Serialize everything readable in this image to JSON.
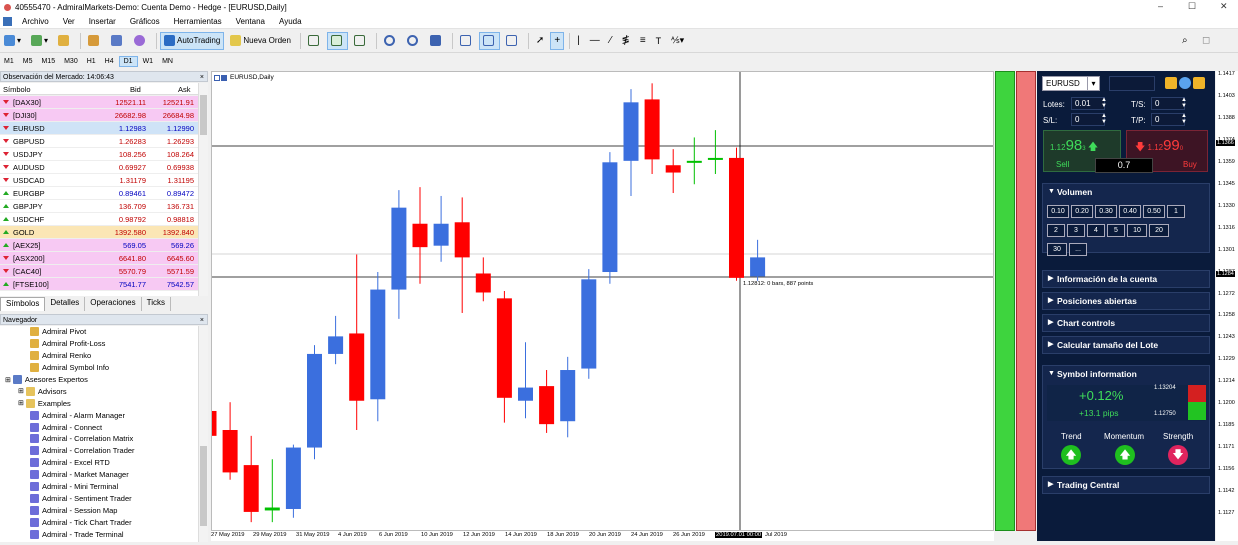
{
  "titlebar": {
    "title": "40555470 - AdmiralMarkets-Demo: Cuenta Demo - Hedge - [EURUSD,Daily]",
    "minimize": "–",
    "maximize": "☐",
    "close": "✕"
  },
  "menu": [
    "Archivo",
    "Ver",
    "Insertar",
    "Gráficos",
    "Herramientas",
    "Ventana",
    "Ayuda"
  ],
  "toolbar": {
    "autotrading": "AutoTrading",
    "new_order": "Nueva Orden"
  },
  "timeframes": [
    "M1",
    "M5",
    "M15",
    "M30",
    "H1",
    "H4",
    "D1",
    "W1",
    "MN"
  ],
  "market_watch": {
    "title": "Observación del Mercado: 14:06:43",
    "col_symbol": "Símbolo",
    "col_bid": "Bid",
    "col_ask": "Ask",
    "rows": [
      {
        "symbol": "[DAX30]",
        "bid": "12521.11",
        "ask": "12521.91",
        "dir": "dn",
        "bg": "#f7c9f3",
        "color": "#c00000"
      },
      {
        "symbol": "[DJI30]",
        "bid": "26682.98",
        "ask": "26684.98",
        "dir": "dn",
        "bg": "#f7c9f3",
        "color": "#c00000"
      },
      {
        "symbol": "EURUSD",
        "bid": "1.12983",
        "ask": "1.12990",
        "dir": "dn",
        "bg": "#cfe3f7",
        "color": "#0000c0"
      },
      {
        "symbol": "GBPUSD",
        "bid": "1.26283",
        "ask": "1.26293",
        "dir": "dn",
        "bg": "#ffffff",
        "color": "#c00000"
      },
      {
        "symbol": "USDJPY",
        "bid": "108.256",
        "ask": "108.264",
        "dir": "dn",
        "bg": "#ffffff",
        "color": "#c00000"
      },
      {
        "symbol": "AUDUSD",
        "bid": "0.69927",
        "ask": "0.69938",
        "dir": "dn",
        "bg": "#ffffff",
        "color": "#c00000"
      },
      {
        "symbol": "USDCAD",
        "bid": "1.31179",
        "ask": "1.31195",
        "dir": "dn",
        "bg": "#ffffff",
        "color": "#c00000"
      },
      {
        "symbol": "EURGBP",
        "bid": "0.89461",
        "ask": "0.89472",
        "dir": "up",
        "bg": "#ffffff",
        "color": "#0000c0"
      },
      {
        "symbol": "GBPJPY",
        "bid": "136.709",
        "ask": "136.731",
        "dir": "up",
        "bg": "#ffffff",
        "color": "#c00000"
      },
      {
        "symbol": "USDCHF",
        "bid": "0.98792",
        "ask": "0.98818",
        "dir": "up",
        "bg": "#ffffff",
        "color": "#c00000"
      },
      {
        "symbol": "GOLD",
        "bid": "1392.580",
        "ask": "1392.840",
        "dir": "up",
        "bg": "#fbe6b5",
        "color": "#c00000"
      },
      {
        "symbol": "[AEX25]",
        "bid": "569.05",
        "ask": "569.26",
        "dir": "up",
        "bg": "#f7c9f3",
        "color": "#0000c0"
      },
      {
        "symbol": "[ASX200]",
        "bid": "6641.80",
        "ask": "6645.60",
        "dir": "dn",
        "bg": "#f7c9f3",
        "color": "#c00000"
      },
      {
        "symbol": "[CAC40]",
        "bid": "5570.79",
        "ask": "5571.59",
        "dir": "dn",
        "bg": "#f7c9f3",
        "color": "#c00000"
      },
      {
        "symbol": "[FTSE100]",
        "bid": "7541.77",
        "ask": "7542.57",
        "dir": "up",
        "bg": "#f7c9f3",
        "color": "#0000c0"
      }
    ],
    "tabs": [
      "Símbolos",
      "Detalles",
      "Operaciones",
      "Ticks"
    ]
  },
  "navigator": {
    "title": "Navegador",
    "items": [
      {
        "label": "Admiral Pivot",
        "indent": 30,
        "icon": "indicator-icon"
      },
      {
        "label": "Admiral Profit-Loss",
        "indent": 30,
        "icon": "indicator-icon"
      },
      {
        "label": "Admiral Renko",
        "indent": 30,
        "icon": "indicator-icon"
      },
      {
        "label": "Admiral Symbol Info",
        "indent": 30,
        "icon": "indicator-icon"
      },
      {
        "label": "Asesores Expertos",
        "indent": 5,
        "icon": "expert-advisor-icon"
      },
      {
        "label": "Advisors",
        "indent": 18,
        "icon": "folder-icon"
      },
      {
        "label": "Examples",
        "indent": 18,
        "icon": "folder-icon"
      },
      {
        "label": "Admiral - Alarm Manager",
        "indent": 30,
        "icon": "expert-icon"
      },
      {
        "label": "Admiral - Connect",
        "indent": 30,
        "icon": "expert-icon"
      },
      {
        "label": "Admiral - Correlation Matrix",
        "indent": 30,
        "icon": "expert-icon"
      },
      {
        "label": "Admiral - Correlation Trader",
        "indent": 30,
        "icon": "expert-icon"
      },
      {
        "label": "Admiral - Excel RTD",
        "indent": 30,
        "icon": "expert-icon"
      },
      {
        "label": "Admiral - Market Manager",
        "indent": 30,
        "icon": "expert-icon"
      },
      {
        "label": "Admiral - Mini Terminal",
        "indent": 30,
        "icon": "expert-icon"
      },
      {
        "label": "Admiral - Sentiment Trader",
        "indent": 30,
        "icon": "expert-icon"
      },
      {
        "label": "Admiral - Session Map",
        "indent": 30,
        "icon": "expert-icon"
      },
      {
        "label": "Admiral - Tick Chart Trader",
        "indent": 30,
        "icon": "expert-icon"
      },
      {
        "label": "Admiral - Trade Terminal",
        "indent": 30,
        "icon": "expert-icon"
      }
    ]
  },
  "chart": {
    "title": "EURUSD,Daily",
    "crosshair_label": "1.12812: 0 bars, 887 points",
    "x_labels": [
      "27 May 2019",
      "29 May 2019",
      "31 May 2019",
      "4 Jun 2019",
      "6 Jun 2019",
      "10 Jun 2019",
      "12 Jun 2019",
      "14 Jun 2019",
      "18 Jun 2019",
      "20 Jun 2019",
      "24 Jun 2019",
      "26 Jun 2019",
      "2019.07.01 00:00",
      "Jul 2019"
    ],
    "y_labels": [
      "1.1417",
      "1.1403",
      "1.1388",
      "1.1374",
      "1.1359",
      "1.1345",
      "1.1330",
      "1.1316",
      "1.1301",
      "1.1287",
      "1.1272",
      "1.1258",
      "1.1243",
      "1.1229",
      "1.1214",
      "1.1200",
      "1.1185",
      "1.1171",
      "1.1156",
      "1.1142",
      "1.1127"
    ],
    "y_highlight_1": "1.1366",
    "y_highlight_2": "1.1284",
    "candles": [
      {
        "o": 1.1193,
        "h": 1.1212,
        "l": 1.117,
        "c": 1.1176
      },
      {
        "o": 1.118,
        "h": 1.1199,
        "l": 1.1146,
        "c": 1.1151
      },
      {
        "o": 1.1156,
        "h": 1.1176,
        "l": 1.1117,
        "c": 1.1124
      },
      {
        "o": 1.1127,
        "h": 1.116,
        "l": 1.1117,
        "c": 1.1125
      },
      {
        "o": 1.1126,
        "h": 1.117,
        "l": 1.112,
        "c": 1.1168
      },
      {
        "o": 1.1168,
        "h": 1.1238,
        "l": 1.116,
        "c": 1.1232
      },
      {
        "o": 1.1232,
        "h": 1.1258,
        "l": 1.1225,
        "c": 1.1244
      },
      {
        "o": 1.1246,
        "h": 1.13,
        "l": 1.118,
        "c": 1.12
      },
      {
        "o": 1.1201,
        "h": 1.1288,
        "l": 1.1186,
        "c": 1.1276
      },
      {
        "o": 1.1276,
        "h": 1.1344,
        "l": 1.1256,
        "c": 1.1332
      },
      {
        "o": 1.1321,
        "h": 1.1346,
        "l": 1.128,
        "c": 1.1305
      },
      {
        "o": 1.1306,
        "h": 1.134,
        "l": 1.1295,
        "c": 1.1321
      },
      {
        "o": 1.1322,
        "h": 1.1339,
        "l": 1.126,
        "c": 1.1298
      },
      {
        "o": 1.1287,
        "h": 1.1298,
        "l": 1.1268,
        "c": 1.1274
      },
      {
        "o": 1.127,
        "h": 1.1275,
        "l": 1.1185,
        "c": 1.1202
      },
      {
        "o": 1.12,
        "h": 1.124,
        "l": 1.1188,
        "c": 1.1209
      },
      {
        "o": 1.121,
        "h": 1.1221,
        "l": 1.1178,
        "c": 1.1184
      },
      {
        "o": 1.1186,
        "h": 1.123,
        "l": 1.1175,
        "c": 1.1221
      },
      {
        "o": 1.1222,
        "h": 1.129,
        "l": 1.1215,
        "c": 1.1283
      },
      {
        "o": 1.1288,
        "h": 1.137,
        "l": 1.128,
        "c": 1.1363
      },
      {
        "o": 1.1364,
        "h": 1.1413,
        "l": 1.134,
        "c": 1.1404
      },
      {
        "o": 1.1406,
        "h": 1.1417,
        "l": 1.1355,
        "c": 1.1365
      },
      {
        "o": 1.1361,
        "h": 1.1372,
        "l": 1.1342,
        "c": 1.1356
      },
      {
        "o": 1.1364,
        "h": 1.138,
        "l": 1.1348,
        "c": 1.1364
      },
      {
        "o": 1.1366,
        "h": 1.1385,
        "l": 1.1355,
        "c": 1.1366
      },
      {
        "o": 1.1366,
        "h": 1.1373,
        "l": 1.1282,
        "c": 1.1284
      },
      {
        "o": 1.1285,
        "h": 1.131,
        "l": 1.1282,
        "c": 1.1298
      }
    ],
    "up_color": "#3b6fde",
    "down_color": "#ff0000",
    "neutral_color": "#00c000",
    "ymax": 1.1422,
    "ymin": 1.1113
  },
  "trade_panel": {
    "symbol": "EURUSD",
    "lotes_label": "Lotes:",
    "lotes": "0.01",
    "ts_label": "T/S:",
    "ts": "0",
    "sl_label": "S/L:",
    "sl": "0",
    "tp_label": "T/P:",
    "tp": "0",
    "sell_price_small": "1.12",
    "sell_price_big": "98",
    "sell_price_sup": "3",
    "buy_price_small": "1.12",
    "buy_price_big": "99",
    "buy_price_sup": "0",
    "sell_label": "Sell",
    "buy_label": "Buy",
    "spread": "0.7",
    "volume_title": "Volumen",
    "volumes": [
      "0.10",
      "0.20",
      "0.30",
      "0.40",
      "0.50",
      "1",
      "2",
      "3",
      "4",
      "5",
      "10",
      "20",
      "30",
      "..."
    ],
    "sections": [
      "Información de la cuenta",
      "Posiciones abiertas",
      "Chart controls",
      "Calcular tamaño del Lote"
    ],
    "symbol_info_title": "Symbol information",
    "change_pct": "+0.12%",
    "change_pips": "+13.1 pips",
    "high": "1.13204",
    "low": "1.12750",
    "trend_label": "Trend",
    "momentum_label": "Momentum",
    "strength_label": "Strength",
    "trading_central": "Trading Central"
  }
}
